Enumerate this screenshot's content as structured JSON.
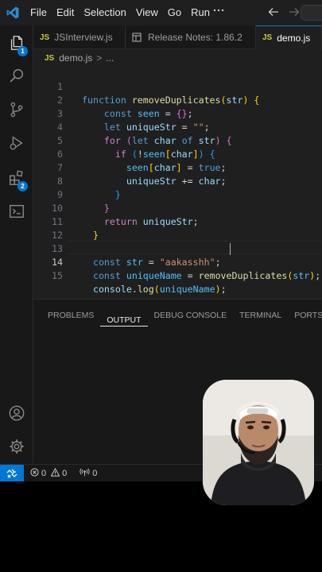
{
  "menu": [
    "File",
    "Edit",
    "Selection",
    "View",
    "Go",
    "Run"
  ],
  "tabs": [
    {
      "lang": "JS",
      "label": "JSInterview.js"
    },
    {
      "label": "Release Notes: 1.86.2"
    },
    {
      "lang": "JS",
      "label": "demo.js"
    }
  ],
  "breadcrumb": {
    "lang": "JS",
    "file": "demo.js",
    "sep": ">",
    "rest": "..."
  },
  "badges": {
    "explorer": "1",
    "extensions": "2"
  },
  "line_numbers": [
    "1",
    "2",
    "3",
    "4",
    "5",
    "6",
    "7",
    "8",
    "9",
    "10",
    "11",
    "12",
    "13",
    "14",
    "15"
  ],
  "current_line": "14",
  "code": {
    "l1": {
      "kw": "function",
      "fn": "removeDuplicates",
      "open": "(",
      "param": "str",
      "close": ")",
      "brace": "{"
    },
    "l2": {
      "kw": "const",
      "var": "seen",
      "eq": "=",
      "obj": "{}",
      "semi": ";"
    },
    "l3": {
      "kw": "let",
      "var": "uniqueStr",
      "eq": "=",
      "str": "\"\"",
      "semi": ";"
    },
    "l4": {
      "kw": "for",
      "open": "(",
      "let": "let",
      "var": "char",
      "of": "of",
      "src": "str",
      "close": ")",
      "brace": "{"
    },
    "l5": {
      "kw": "if",
      "open": "(",
      "not": "!",
      "obj": "seen",
      "lb": "[",
      "key": "char",
      "rb": "]",
      "close": ")",
      "brace": "{"
    },
    "l6": {
      "obj": "seen",
      "lb": "[",
      "key": "char",
      "rb": "]",
      "eq": "=",
      "val": "true",
      "semi": ";"
    },
    "l7": {
      "var": "uniqueStr",
      "op": "+=",
      "val": "char",
      "semi": ";"
    },
    "l8": {
      "brace": "}"
    },
    "l9": {
      "brace": "}"
    },
    "l10": {
      "kw": "return",
      "var": "uniqueStr",
      "semi": ";"
    },
    "l11": {
      "brace": "}"
    },
    "l13": {
      "kw": "const",
      "var": "str",
      "eq": "=",
      "str": "\"aakasshh\"",
      "semi": ";"
    },
    "l14": {
      "kw": "const",
      "var": "uniqueName",
      "eq": "=",
      "fn": "removeDuplicates",
      "open": "(",
      "arg": "str",
      "close": ")",
      "semi": ";"
    },
    "l15": {
      "obj": "console",
      "dot": ".",
      "fn": "log",
      "open": "(",
      "arg": "uniqueName",
      "close": ")",
      "semi": ";"
    }
  },
  "panel_tabs": [
    "PROBLEMS",
    "OUTPUT",
    "DEBUG CONSOLE",
    "TERMINAL",
    "PORTS"
  ],
  "panel_active": "OUTPUT",
  "status": {
    "errors": "0",
    "warnings": "0",
    "ports": "0"
  },
  "colors": {
    "accent": "#0078d4",
    "editor_bg": "#1f1f1f",
    "sidebar_bg": "#181818"
  },
  "icons": [
    "vscode-logo-icon",
    "explorer-icon",
    "search-icon",
    "source-control-icon",
    "run-debug-icon",
    "extensions-icon",
    "terminal-icon",
    "account-icon",
    "settings-gear-icon",
    "back-arrow-icon",
    "forward-arrow-icon",
    "remote-icon",
    "error-icon",
    "warning-icon",
    "broadcast-icon"
  ]
}
